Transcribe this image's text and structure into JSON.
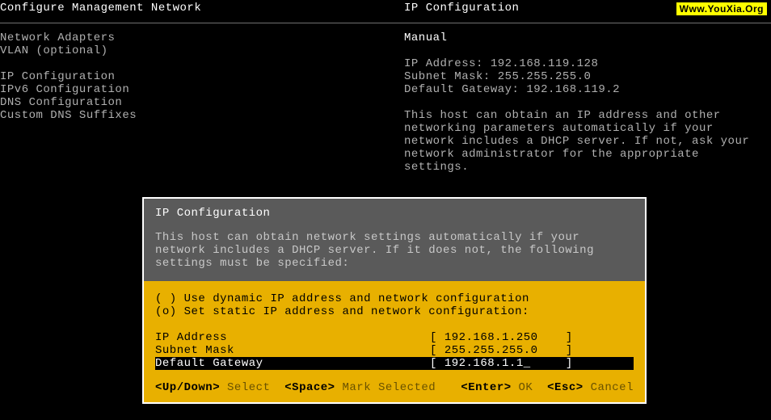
{
  "header": {
    "left": "Configure Management Network",
    "right": "IP Configuration"
  },
  "watermark": "Www.YouXia.Org",
  "left_menu": {
    "group1": [
      "Network Adapters",
      "VLAN (optional)"
    ],
    "group2": [
      "IP Configuration",
      "IPv6 Configuration",
      "DNS Configuration",
      "Custom DNS Suffixes"
    ]
  },
  "right_panel": {
    "mode": "Manual",
    "ip_label": "IP Address:",
    "ip_value": "192.168.119.128",
    "mask_label": "Subnet Mask:",
    "mask_value": "255.255.255.0",
    "gw_label": "Default Gateway:",
    "gw_value": "192.168.119.2",
    "para": "This host can obtain an IP address and other networking parameters automatically if your network includes a DHCP server. If not, ask your network administrator for the appropriate settings."
  },
  "dialog": {
    "title": "IP Configuration",
    "desc": "This host can obtain network settings automatically if your network includes a DHCP server. If it does not, the following settings must be specified:",
    "options": {
      "dynamic": {
        "marker": "( )",
        "label": "Use dynamic IP address and network configuration"
      },
      "static": {
        "marker": "(o)",
        "label": "Set static IP address and network configuration:"
      }
    },
    "fields": {
      "ip": {
        "label": "IP Address",
        "value": "192.168.1.250",
        "selected": false
      },
      "mask": {
        "label": "Subnet Mask",
        "value": "255.255.255.0",
        "selected": false
      },
      "gw": {
        "label": "Default Gateway",
        "value": "192.168.1.1",
        "selected": true
      }
    },
    "footer": {
      "updown_key": "<Up/Down>",
      "updown_action": "Select",
      "space_key": "<Space>",
      "space_action": "Mark Selected",
      "enter_key": "<Enter>",
      "enter_action": "OK",
      "esc_key": "<Esc>",
      "esc_action": "Cancel"
    }
  }
}
